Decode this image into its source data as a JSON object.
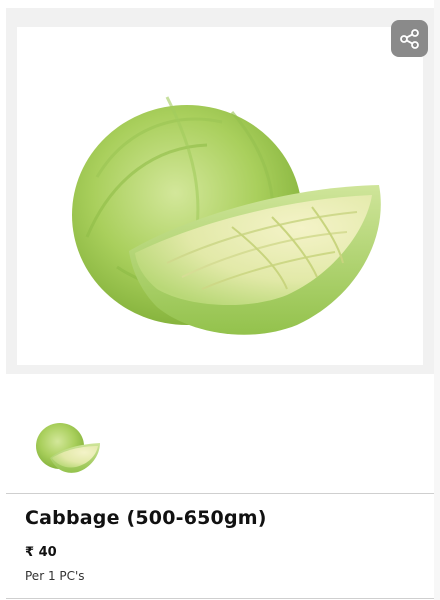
{
  "product": {
    "name": "Cabbage (500-650gm)",
    "price": "₹ 40",
    "unit": "Per 1 PC's"
  },
  "icons": {
    "share": "share-icon"
  },
  "gallery": {
    "thumbnails": [
      "cabbage"
    ]
  },
  "colors": {
    "share_bg": "#8a8a8a",
    "cabbage_light": "#c7e08a",
    "cabbage_dark": "#8dbb3d"
  }
}
